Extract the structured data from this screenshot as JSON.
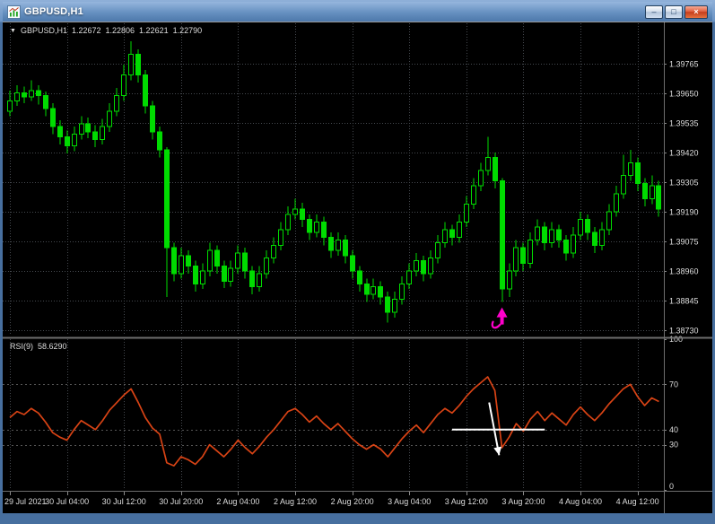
{
  "window": {
    "title": "GBPUSD,H1",
    "controls": {
      "minimize": "–",
      "maximize": "□",
      "close": "×"
    }
  },
  "quote_bar": {
    "dropdown_icon": "▼",
    "symbol": "GBPUSD,H1",
    "open": "1.22672",
    "high": "1.22806",
    "low": "1.22621",
    "close": "1.22790"
  },
  "rsi_label": {
    "name": "RSI(9)",
    "value": "58.6290"
  },
  "colors": {
    "background": "#000000",
    "grid": "#45494f",
    "candle": "#00dc00",
    "candle_bull_fill": "#000000",
    "candle_bear_fill": "#00dc00",
    "rsi_line": "#d84315",
    "rsi_level": "#565656",
    "axis_text": "#dedede",
    "separator": "#6e6e6e",
    "border_light": "#9a9a9a",
    "buy_arrow": "#ff00cc",
    "annotation": "#ffffff"
  },
  "chart_data": {
    "type": "candlestick",
    "symbol": "GBPUSD",
    "timeframe": "H1",
    "price_ticks": [
      "1.39765",
      "1.39650",
      "1.39535",
      "1.39420",
      "1.39305",
      "1.39190",
      "1.39075",
      "1.38960",
      "1.38845",
      "1.38730"
    ],
    "price_range": {
      "max": 1.3992,
      "min": 1.3871
    },
    "time_ticks": {
      "indices": [
        0,
        8,
        16,
        24,
        32,
        40,
        48,
        56,
        64,
        72,
        80,
        88
      ],
      "labels": [
        "29 Jul 2021",
        "30 Jul 04:00",
        "30 Jul 12:00",
        "30 Jul 20:00",
        "2 Aug 04:00",
        "2 Aug 12:00",
        "2 Aug 20:00",
        "3 Aug 04:00",
        "3 Aug 12:00",
        "3 Aug 20:00",
        "4 Aug 04:00",
        "4 Aug 12:00"
      ]
    },
    "candles": [
      [
        1.3958,
        1.3966,
        1.3956,
        1.3962
      ],
      [
        1.3962,
        1.3968,
        1.396,
        1.3965
      ],
      [
        1.3965,
        1.39675,
        1.3961,
        1.39635
      ],
      [
        1.39635,
        1.397,
        1.3962,
        1.3966
      ],
      [
        1.3966,
        1.3968,
        1.39605,
        1.3964
      ],
      [
        1.3964,
        1.39655,
        1.3956,
        1.3959
      ],
      [
        1.3959,
        1.3961,
        1.3949,
        1.3952
      ],
      [
        1.3952,
        1.39545,
        1.3945,
        1.3948
      ],
      [
        1.3948,
        1.39505,
        1.39415,
        1.39445
      ],
      [
        1.39445,
        1.3952,
        1.39425,
        1.3949
      ],
      [
        1.3949,
        1.3956,
        1.3947,
        1.3953
      ],
      [
        1.3953,
        1.39555,
        1.39475,
        1.395
      ],
      [
        1.395,
        1.39525,
        1.3944,
        1.3947
      ],
      [
        1.3947,
        1.3955,
        1.3945,
        1.3952
      ],
      [
        1.3952,
        1.3961,
        1.395,
        1.3958
      ],
      [
        1.3958,
        1.3967,
        1.3956,
        1.3964
      ],
      [
        1.3964,
        1.3976,
        1.3962,
        1.3972
      ],
      [
        1.3972,
        1.3985,
        1.397,
        1.398
      ],
      [
        1.398,
        1.3982,
        1.3969,
        1.3972
      ],
      [
        1.3972,
        1.3974,
        1.3957,
        1.396
      ],
      [
        1.396,
        1.3962,
        1.3947,
        1.395
      ],
      [
        1.395,
        1.3952,
        1.394,
        1.3943
      ],
      [
        1.3943,
        1.3944,
        1.3886,
        1.3905
      ],
      [
        1.3905,
        1.3907,
        1.3892,
        1.3895
      ],
      [
        1.3895,
        1.3905,
        1.3893,
        1.3902
      ],
      [
        1.3902,
        1.3904,
        1.3895,
        1.3898
      ],
      [
        1.3898,
        1.39,
        1.3888,
        1.3891
      ],
      [
        1.3891,
        1.3899,
        1.3889,
        1.3896
      ],
      [
        1.3896,
        1.3907,
        1.3894,
        1.3904
      ],
      [
        1.3904,
        1.3906,
        1.3895,
        1.3898
      ],
      [
        1.3898,
        1.39,
        1.38895,
        1.3892
      ],
      [
        1.3892,
        1.39,
        1.389,
        1.3897
      ],
      [
        1.3897,
        1.3906,
        1.3895,
        1.3903
      ],
      [
        1.3903,
        1.3905,
        1.3893,
        1.3896
      ],
      [
        1.3896,
        1.3898,
        1.3887,
        1.389
      ],
      [
        1.389,
        1.3898,
        1.3888,
        1.3895
      ],
      [
        1.3895,
        1.3904,
        1.3893,
        1.3901
      ],
      [
        1.3901,
        1.3909,
        1.3899,
        1.3906
      ],
      [
        1.3906,
        1.3915,
        1.3904,
        1.3912
      ],
      [
        1.3912,
        1.3921,
        1.391,
        1.3918
      ],
      [
        1.3918,
        1.3924,
        1.3916,
        1.392
      ],
      [
        1.392,
        1.39225,
        1.3913,
        1.3916
      ],
      [
        1.3916,
        1.3918,
        1.3908,
        1.3911
      ],
      [
        1.3911,
        1.3918,
        1.3909,
        1.3915
      ],
      [
        1.3915,
        1.3917,
        1.3906,
        1.3909
      ],
      [
        1.3909,
        1.3911,
        1.3901,
        1.3904
      ],
      [
        1.3904,
        1.3911,
        1.3902,
        1.3908
      ],
      [
        1.3908,
        1.391,
        1.3899,
        1.3902
      ],
      [
        1.3902,
        1.3904,
        1.3893,
        1.3896
      ],
      [
        1.3896,
        1.3898,
        1.3888,
        1.3891
      ],
      [
        1.3891,
        1.3893,
        1.3884,
        1.3887
      ],
      [
        1.3887,
        1.3893,
        1.3885,
        1.389
      ],
      [
        1.389,
        1.3892,
        1.3883,
        1.3886
      ],
      [
        1.3886,
        1.3888,
        1.3876,
        1.388
      ],
      [
        1.388,
        1.3888,
        1.3878,
        1.3885
      ],
      [
        1.3885,
        1.3894,
        1.3883,
        1.3891
      ],
      [
        1.3891,
        1.3899,
        1.3889,
        1.3896
      ],
      [
        1.3896,
        1.3903,
        1.3894,
        1.39
      ],
      [
        1.39,
        1.3902,
        1.3892,
        1.3895
      ],
      [
        1.3895,
        1.3904,
        1.3893,
        1.3901
      ],
      [
        1.3901,
        1.391,
        1.3899,
        1.3907
      ],
      [
        1.3907,
        1.3915,
        1.3905,
        1.3912
      ],
      [
        1.3912,
        1.3914,
        1.3906,
        1.3909
      ],
      [
        1.3909,
        1.3918,
        1.3907,
        1.3915
      ],
      [
        1.3915,
        1.3925,
        1.3913,
        1.3922
      ],
      [
        1.3922,
        1.3932,
        1.392,
        1.3929
      ],
      [
        1.3929,
        1.3938,
        1.3927,
        1.3935
      ],
      [
        1.3935,
        1.3948,
        1.3933,
        1.394
      ],
      [
        1.394,
        1.3942,
        1.3928,
        1.3931
      ],
      [
        1.3931,
        1.3932,
        1.3884,
        1.3889
      ],
      [
        1.3889,
        1.3899,
        1.3886,
        1.3896
      ],
      [
        1.3896,
        1.3908,
        1.3894,
        1.3905
      ],
      [
        1.3905,
        1.3907,
        1.3896,
        1.3899
      ],
      [
        1.3899,
        1.3911,
        1.3897,
        1.3908
      ],
      [
        1.3908,
        1.3916,
        1.3906,
        1.3913
      ],
      [
        1.3913,
        1.3915,
        1.3904,
        1.3907
      ],
      [
        1.3907,
        1.3915,
        1.3905,
        1.3912
      ],
      [
        1.3912,
        1.3914,
        1.3905,
        1.3908
      ],
      [
        1.3908,
        1.391,
        1.39,
        1.3903
      ],
      [
        1.3903,
        1.3913,
        1.3901,
        1.391
      ],
      [
        1.391,
        1.3919,
        1.3908,
        1.3916
      ],
      [
        1.3916,
        1.3918,
        1.3908,
        1.3911
      ],
      [
        1.3911,
        1.3913,
        1.3903,
        1.3906
      ],
      [
        1.3906,
        1.3915,
        1.3904,
        1.3912
      ],
      [
        1.3912,
        1.3922,
        1.391,
        1.3919
      ],
      [
        1.3919,
        1.3929,
        1.3917,
        1.3926
      ],
      [
        1.3926,
        1.3941,
        1.3924,
        1.3933
      ],
      [
        1.3933,
        1.3943,
        1.3931,
        1.3938
      ],
      [
        1.3938,
        1.394,
        1.3927,
        1.393
      ],
      [
        1.393,
        1.3932,
        1.3921,
        1.3924
      ],
      [
        1.3924,
        1.3933,
        1.3922,
        1.3929
      ],
      [
        1.3929,
        1.3931,
        1.3917,
        1.392
      ]
    ],
    "rsi": {
      "period": 9,
      "current": 58.629,
      "axis_ticks": [
        100,
        70,
        40,
        30,
        0
      ],
      "levels": [
        70,
        40,
        30
      ],
      "values": [
        48,
        52,
        50,
        54,
        51,
        45,
        38,
        35,
        33,
        40,
        46,
        43,
        40,
        46,
        53,
        58,
        63,
        67,
        58,
        48,
        41,
        37,
        18,
        16,
        22,
        20,
        17,
        22,
        30,
        26,
        22,
        27,
        33,
        28,
        24,
        29,
        35,
        40,
        46,
        52,
        54,
        50,
        45,
        49,
        44,
        40,
        44,
        39,
        34,
        30,
        27,
        30,
        27,
        22,
        28,
        34,
        39,
        43,
        38,
        44,
        50,
        54,
        51,
        56,
        62,
        67,
        71,
        75,
        66,
        28,
        35,
        44,
        39,
        47,
        52,
        46,
        51,
        47,
        43,
        50,
        55,
        50,
        46,
        51,
        57,
        62,
        67,
        70,
        62,
        56,
        61,
        58.63
      ]
    },
    "annotations": [
      {
        "type": "buy_arrow",
        "candle_index": 69,
        "price": 1.3884,
        "color": "#ff00cc"
      },
      {
        "type": "hline_segment",
        "panel": "rsi",
        "level": 40,
        "from_index": 62,
        "to_index": 75,
        "color": "#ffffff"
      },
      {
        "type": "arrow",
        "panel": "rsi",
        "from": {
          "index": 67.2,
          "value": 58
        },
        "to": {
          "index": 68.6,
          "value": 23
        },
        "color": "#ffffff"
      }
    ]
  }
}
